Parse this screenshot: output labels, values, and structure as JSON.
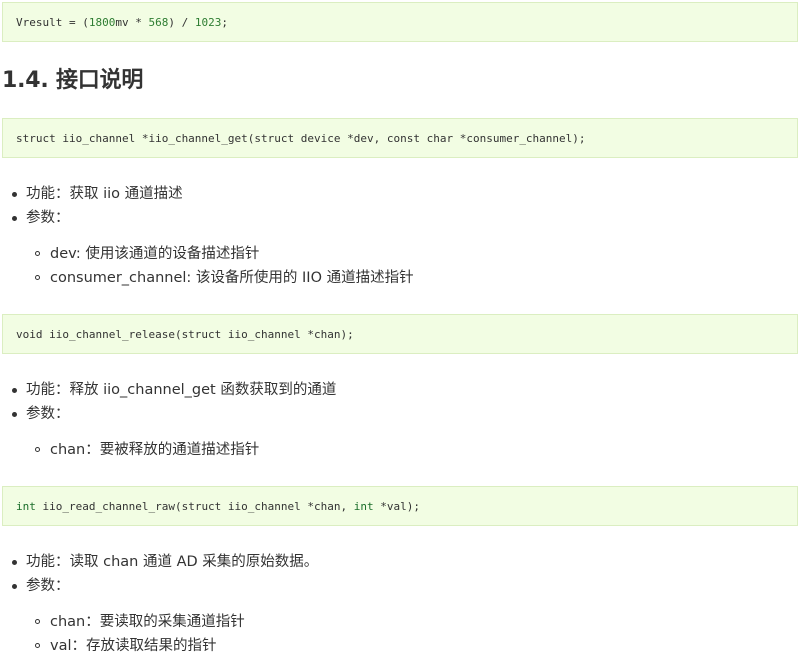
{
  "code_blocks": [
    {
      "pre": "Vresult = (",
      "n1": "1800",
      "mid1": "mv * ",
      "n2": "568",
      "mid2": ") / ",
      "n3": "1023",
      "post": ";"
    },
    {
      "text": "struct iio_channel *iio_channel_get(struct device *dev, const char *consumer_channel);"
    },
    {
      "text": "void iio_channel_release(struct iio_channel *chan);"
    },
    {
      "kw1": "int",
      "mid": " iio_read_channel_raw(struct iio_channel *chan, ",
      "kw2": "int",
      "post": " *val);"
    }
  ],
  "heading": "1.4. 接口说明",
  "sections": [
    {
      "items": [
        "功能：获取 iio 通道描述",
        "参数："
      ],
      "sub": [
        "dev: 使用该通道的设备描述指针",
        "consumer_channel: 该设备所使用的 IIO 通道描述指针"
      ]
    },
    {
      "items": [
        "功能：释放 iio_channel_get 函数获取到的通道",
        "参数："
      ],
      "sub": [
        "chan：要被释放的通道描述指针"
      ]
    },
    {
      "items": [
        "功能：读取 chan 通道 AD 采集的原始数据。",
        "参数："
      ],
      "sub": [
        "chan：要读取的采集通道指针",
        "val：存放读取结果的指针"
      ]
    }
  ]
}
